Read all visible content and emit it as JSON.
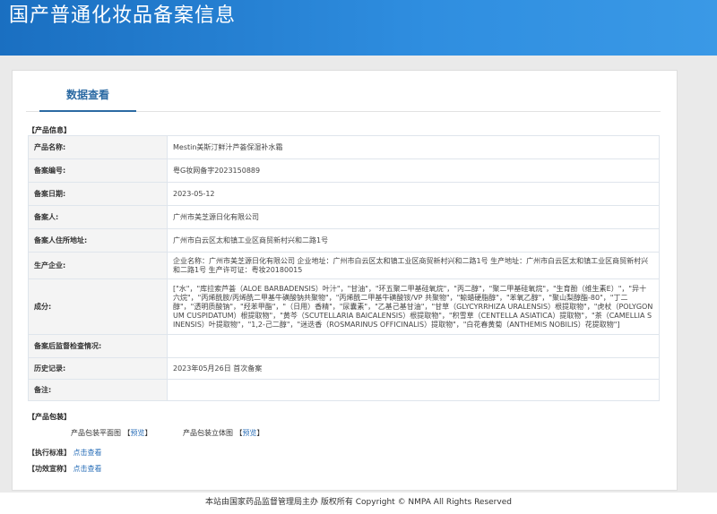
{
  "header": {
    "title": "国产普通化妆品备案信息"
  },
  "tabs": [
    {
      "label": "数据查看"
    }
  ],
  "product_section": {
    "label": "【产品信息】"
  },
  "product_rows": [
    {
      "key": "产品名称:",
      "value": "Mestin美斯汀鲜汁芦荟保湿补水霜"
    },
    {
      "key": "备案编号:",
      "value": "粤G妆网备字2023150889"
    },
    {
      "key": "备案日期:",
      "value": "2023-05-12"
    },
    {
      "key": "备案人:",
      "value": "广州市美芝源日化有限公司"
    },
    {
      "key": "备案人住所地址:",
      "value": "广州市白云区太和镇工业区商贸新村兴和二路1号"
    },
    {
      "key": "生产企业:",
      "value": "企业名称：广州市美芝源日化有限公司 企业地址：广州市白云区太和镇工业区商贸新村兴和二路1号 生产地址：广州市白云区太和镇工业区商贸新村兴和二路1号 生产许可证：粤妆20180015"
    },
    {
      "key": "成分:",
      "value": "[\"水\"，\"库拉索芦荟（ALOE BARBADENSIS）叶汁\"，\"甘油\"，\"环五聚二甲基硅氧烷\"，\"丙二醇\"，\"聚二甲基硅氧烷\"，\"生育酚（维生素E）\"，\"异十六烷\"，\"丙烯酰胺/丙烯酰二甲基牛磺酸钠共聚物\"，\"丙烯酰二甲基牛磺酸铵/VP 共聚物\"，\"鲸蜡硬脂醇\"，\"苯氧乙醇\"，\"聚山梨醇酯-80\"，\"丁二醇\"，\"透明质酸钠\"，\"羟苯甲酯\"，\"（日用）香精\"，\"尿囊素\"，\"乙基己基甘油\"，\"甘草（GLYCYRRHIZA URALENSIS）根提取物\"，\"虎杖（POLYGONUM CUSPIDATUM）根提取物\"，\"黄芩（SCUTELLARIA BAICALENSIS）根提取物\"，\"积雪草（CENTELLA ASIATICA）提取物\"，\"茶（CAMELLIA SINENSIS）叶提取物\"，\"1,2-己二醇\"，\"迷迭香（ROSMARINUS OFFICINALIS）提取物\"，\"白花春黄菊（ANTHEMIS NOBILIS）花提取物\"]"
    },
    {
      "key": "备案后监督检查情况:",
      "value": ""
    },
    {
      "key": "历史记录:",
      "value": "2023年05月26日 首次备案"
    },
    {
      "key": "备注:",
      "value": ""
    }
  ],
  "package_section": {
    "label": "【产品包装】",
    "flat_label": "产品包装平面图",
    "stereo_label": "产品包装立体图",
    "preview_link": "预览",
    "bracket_open": "【",
    "bracket_close": "】"
  },
  "standard_section": {
    "label": "【执行标准】",
    "link": "点击查看"
  },
  "efficacy_section": {
    "label": "【功效宣称】",
    "link": "点击查看"
  },
  "footer": {
    "text": "本站由国家药品监督管理局主办 版权所有 Copyright © NMPA All Rights Reserved"
  }
}
